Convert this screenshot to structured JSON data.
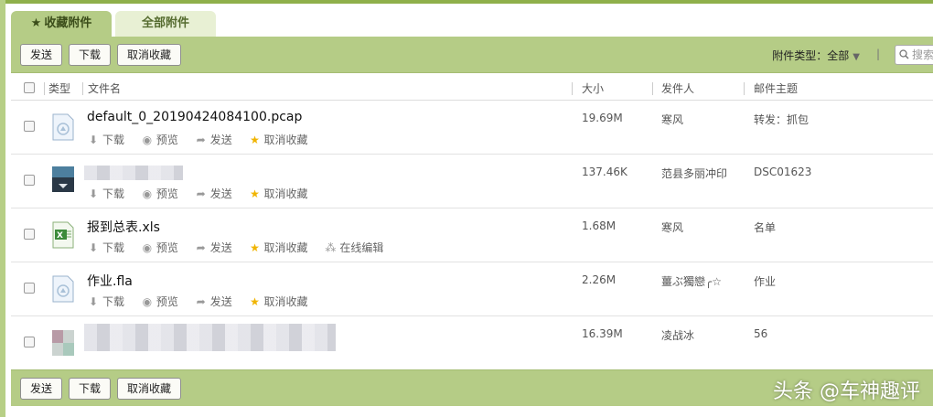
{
  "tabs": [
    {
      "label": "收藏附件",
      "active": true,
      "star": "★"
    },
    {
      "label": "全部附件",
      "active": false
    }
  ],
  "toolbar": {
    "send_label": "发送",
    "download_label": "下载",
    "unfavorite_label": "取消收藏",
    "filter_label": "附件类型：",
    "filter_value": "全部",
    "search_placeholder": "搜索"
  },
  "table": {
    "headers": {
      "type": "类型",
      "filename": "文件名",
      "size": "大小",
      "sender": "发件人",
      "subject": "邮件主题"
    },
    "action_labels": {
      "download": "下载",
      "preview": "预览",
      "send": "发送",
      "unfavorite": "取消收藏",
      "online_edit": "在线编辑"
    },
    "rows": [
      {
        "name": "default_0_20190424084100.pcap",
        "icon": "generic-file-icon",
        "size": "19.69M",
        "sender": "寒风",
        "subject": "转发：抓包",
        "online_edit": false
      },
      {
        "name": "",
        "icon": "image-thumbnail-icon",
        "size": "137.46K",
        "sender": "范县多丽冲印",
        "subject": "DSC01623",
        "online_edit": false
      },
      {
        "name": "报到总表.xls",
        "icon": "excel-file-icon",
        "size": "1.68M",
        "sender": "寒风",
        "subject": "名单",
        "online_edit": true
      },
      {
        "name": "作业.fla",
        "icon": "generic-file-icon",
        "size": "2.26M",
        "sender": "薑ぶ獨戀╭☆",
        "subject": "作业",
        "online_edit": false
      },
      {
        "name": "",
        "icon": "image-thumbnail-icon",
        "size": "16.39M",
        "sender": "凌战冰",
        "subject": "56",
        "online_edit": false
      }
    ]
  },
  "watermark": "头条 @车神趣评",
  "colors": {
    "accent": "#b5cc86",
    "border": "#8fb04b",
    "star": "#f0b400"
  }
}
